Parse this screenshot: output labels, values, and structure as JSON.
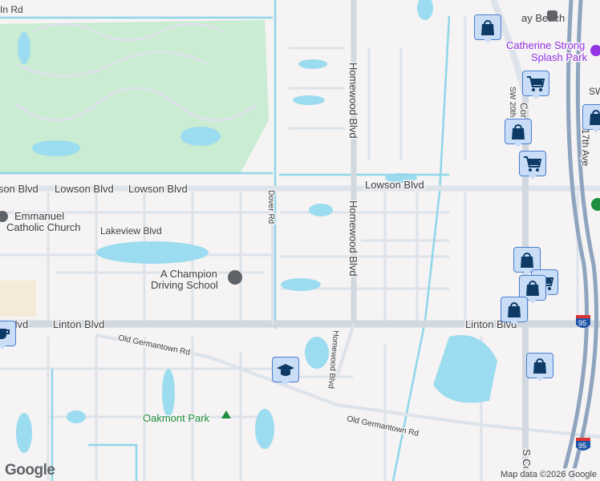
{
  "roads": {
    "lowson_left": "Lowson Blvd",
    "lowson_mid": "Lowson Blvd",
    "lowson_right": "Lowson Blvd",
    "lowson_edge": "lson Blvd",
    "linton_left": "Linton Blvd",
    "linton_right": "Linton Blvd",
    "linton_edge": "Blvd",
    "homewood_top": "Homewood Blvd",
    "homewood_mid": "Homewood Blvd",
    "homewood_low": "Homewood Blvd",
    "dover": "Dover Rd",
    "lakeview": "Lakeview Blvd",
    "old_germantown_1": "Old Germantown Rd",
    "old_germantown_2": "Old Germantown Rd",
    "top_left": "In Rd",
    "sw20": "SW 20th",
    "congress_top": "Con",
    "sw_right": "SW",
    "sw17": "SW 17th Ave",
    "s_congress": "S Co",
    "i95": "95"
  },
  "places": {
    "delray": "ay Beach",
    "catherine_1": "Catherine Strong",
    "catherine_2": "Splash Park",
    "emmanuel_1": "Emmanuel",
    "emmanuel_2": "Catholic Church",
    "champion_1": "A Champion",
    "champion_2": "Driving School",
    "oakmont": "Oakmont Park"
  },
  "markers": [
    {
      "type": "shopping-bag"
    },
    {
      "type": "shopping-cart"
    },
    {
      "type": "shopping-bag"
    },
    {
      "type": "shopping-cart"
    },
    {
      "type": "shopping-bag"
    },
    {
      "type": "shopping-bag"
    },
    {
      "type": "shopping-cart"
    },
    {
      "type": "shopping-bag"
    },
    {
      "type": "shopping-bag"
    },
    {
      "type": "shopping-bag"
    },
    {
      "type": "school"
    },
    {
      "type": "coffee"
    }
  ],
  "footer": {
    "logo": "Google",
    "attribution": "Map data ©2026 Google"
  },
  "colors": {
    "water": "#9cdcf0",
    "park": "#c9ecd2",
    "road": "#dde3ea",
    "highway": "#8fa4bf",
    "marker_icon": "#0d3b66"
  }
}
